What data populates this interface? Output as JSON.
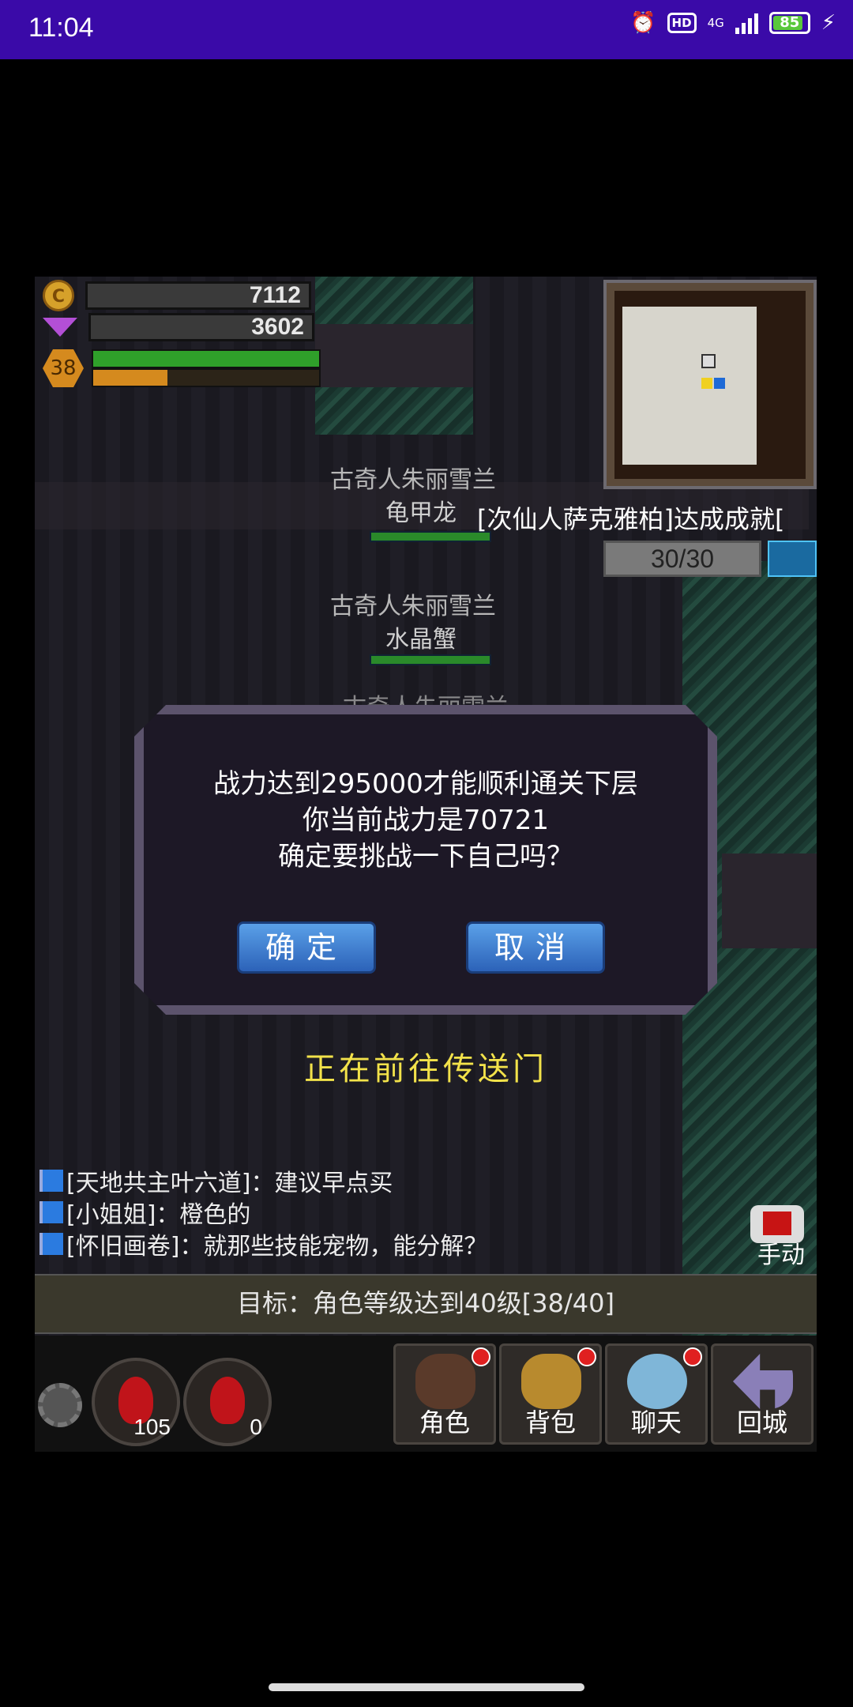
{
  "status_bar": {
    "time": "11:04",
    "network": "4G",
    "battery": "85"
  },
  "hud": {
    "gold": "7112",
    "gems": "3602",
    "level": "38",
    "hp_fraction": 1.0,
    "xp_fraction": 0.33
  },
  "world": {
    "npc1": {
      "title": "古奇人朱丽雪兰",
      "name": "龟甲龙"
    },
    "npc2": {
      "title": "古奇人朱丽雪兰",
      "name": "水晶蟹"
    },
    "npc3": {
      "title": "古奇人朱丽雪兰"
    },
    "announce": "[次仙人萨克雅柏]达成成就[",
    "counter": "30/30"
  },
  "dialog": {
    "line1": "战力达到295000才能顺利通关下层",
    "line2": "你当前战力是70721",
    "line3": "确定要挑战一下自己吗？",
    "confirm": "确定",
    "cancel": "取消"
  },
  "travel_text": "正在前往传送门",
  "chat": [
    "[天地共主叶六道]：建议早点买",
    "[小姐姐]：橙色的",
    "[怀旧画卷]：就那些技能宠物，能分解？"
  ],
  "auto_label": "手动",
  "goal": "目标：角色等级达到40级[38/40]",
  "potions": {
    "hp_count": "105",
    "mp_count": "0"
  },
  "menu": {
    "character": "角色",
    "bag": "背包",
    "chat": "聊天",
    "return": "回城"
  }
}
